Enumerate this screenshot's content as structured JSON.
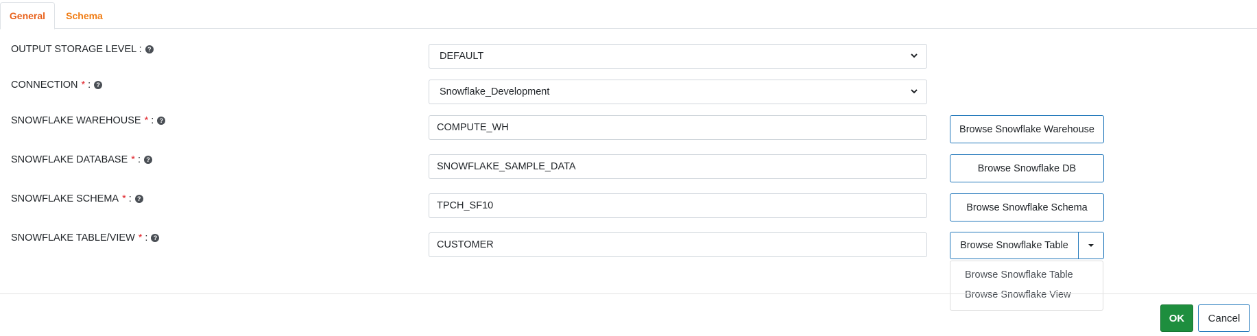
{
  "tabs": [
    {
      "label": "General",
      "active": true
    },
    {
      "label": "Schema",
      "active": false
    }
  ],
  "form": {
    "output_storage_level": {
      "label": "OUTPUT STORAGE LEVEL :",
      "value": "DEFAULT"
    },
    "connection": {
      "label": "CONNECTION",
      "required_mark": "*",
      "colon": ":",
      "value": "Snowflake_Development"
    },
    "warehouse": {
      "label": "SNOWFLAKE WAREHOUSE",
      "required_mark": "*",
      "colon": ":",
      "value": "COMPUTE_WH",
      "button": "Browse Snowflake Warehouse"
    },
    "database": {
      "label": "SNOWFLAKE DATABASE",
      "required_mark": "*",
      "colon": ":",
      "value": "SNOWFLAKE_SAMPLE_DATA",
      "button": "Browse Snowflake DB"
    },
    "schema": {
      "label": "SNOWFLAKE SCHEMA",
      "required_mark": "*",
      "colon": ":",
      "value": "TPCH_SF10",
      "button": "Browse Snowflake Schema"
    },
    "table_view": {
      "label": "SNOWFLAKE TABLE/VIEW",
      "required_mark": "*",
      "colon": ":",
      "value": "CUSTOMER",
      "button": "Browse Snowflake Table"
    }
  },
  "help_icon": "question-circle-icon",
  "dropdown_menu": {
    "items": [
      "Browse Snowflake Table",
      "Browse Snowflake View"
    ]
  },
  "footer": {
    "ok_label": "OK",
    "cancel_label": "Cancel"
  },
  "colors": {
    "tab_accent": "#e8601a",
    "required": "#e0242b",
    "button_border": "#1c74b9",
    "ok_green": "#1e8e3e"
  }
}
